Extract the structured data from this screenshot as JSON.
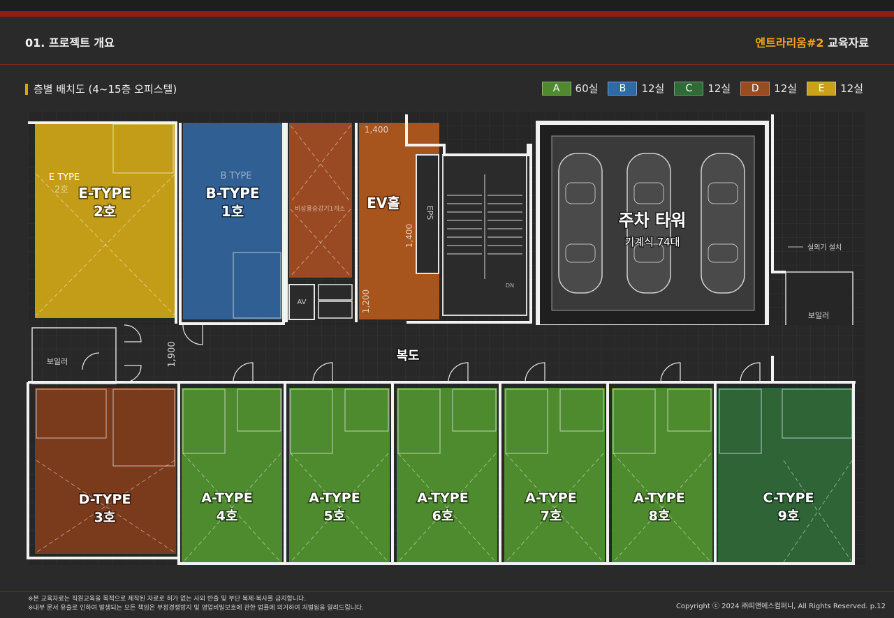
{
  "header": {
    "section": "01. 프로젝트 개요",
    "brand_accent": "엔트라리움#2",
    "brand_rest": " 교육자료"
  },
  "subtitle": "층별 배치도 (4~15층 오피스텔)",
  "legend": [
    {
      "letter": "A",
      "count": "60실",
      "color": "#4e8a2e"
    },
    {
      "letter": "B",
      "count": "12실",
      "color": "#2f6aa8"
    },
    {
      "letter": "C",
      "count": "12실",
      "color": "#2e6b35"
    },
    {
      "letter": "D",
      "count": "12실",
      "color": "#9a4b20"
    },
    {
      "letter": "E",
      "count": "12실",
      "color": "#c9a21a"
    }
  ],
  "rooms": {
    "e_type": {
      "name": "E-TYPE",
      "no": "2호",
      "ghost1": "E TYPE",
      "ghost2": "2호"
    },
    "b_type": {
      "name": "B-TYPE",
      "no": "1호",
      "ghost1": "B TYPE"
    },
    "ev": {
      "name": "EV홀"
    },
    "parking": {
      "name": "주차 타워",
      "sub": "기계식 74대"
    },
    "corridor": {
      "name": "복도"
    },
    "d_type": {
      "name": "D-TYPE",
      "no": "3호"
    },
    "a4": {
      "name": "A-TYPE",
      "no": "4호"
    },
    "a5": {
      "name": "A-TYPE",
      "no": "5호"
    },
    "a6": {
      "name": "A-TYPE",
      "no": "6호"
    },
    "a7": {
      "name": "A-TYPE",
      "no": "7호"
    },
    "a8": {
      "name": "A-TYPE",
      "no": "8호"
    },
    "c_type": {
      "name": "C-TYPE",
      "no": "9호"
    }
  },
  "plan_text": {
    "boiler_left": "보일러",
    "boiler_right": "보일러",
    "outdoor_unit": "실외기 설치",
    "eps": "EPS",
    "av": "AV",
    "dim_1900": "1,900",
    "dim_1400a": "1,400",
    "dim_1400b": "1,400",
    "dim_1200": "1,200",
    "dn": "DN",
    "emergency": "비상용승강기1개소",
    "up": "UP"
  },
  "colors": {
    "a": "#4e8a2e",
    "b": "#2f5f93",
    "c": "#2e6436",
    "d": "#7a3a1c",
    "e": "#c49d18",
    "ev": "#a8541d",
    "ev_room": "#9a4a22"
  },
  "footer": {
    "note1": "※본 교육자료는 직원교육을 목적으로 제작된 자료로 허가 없는 사외 반출 및 부단 복제·복사를 금지합니다.",
    "note2": "※내부 문서 유출로 인하여 발생되는 모든 책임은 부정경쟁방지 및 영업비밀보호에 관한 법률에 의거하여 처벌됨을 알려드립니다.",
    "copyright": "Copyright ⓒ 2024 ㈜피앤에스컴퍼니, All Rights Reserved.   p.12"
  }
}
